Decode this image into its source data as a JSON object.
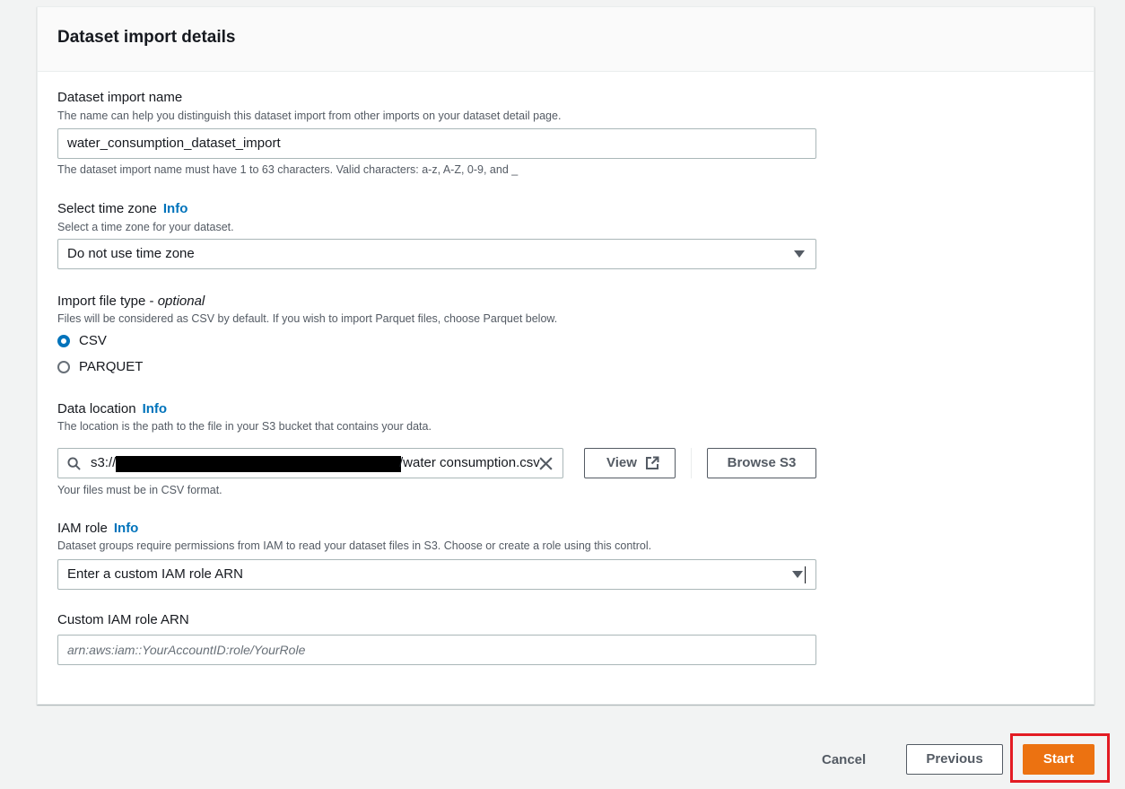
{
  "panel": {
    "title": "Dataset import details"
  },
  "import_name": {
    "label": "Dataset import name",
    "description": "The name can help you distinguish this dataset import from other imports on your dataset detail page.",
    "value": "water_consumption_dataset_import",
    "constraint": "The dataset import name must have 1 to 63 characters. Valid characters: a-z, A-Z, 0-9, and _"
  },
  "time_zone": {
    "label": "Select time zone",
    "info": "Info",
    "description": "Select a time zone for your dataset.",
    "selected": "Do not use time zone"
  },
  "file_type": {
    "label": "Import file type -",
    "label_optional": "optional",
    "description": "Files will be considered as CSV by default. If you wish to import Parquet files, choose Parquet below.",
    "options": [
      {
        "label": "CSV",
        "checked": true
      },
      {
        "label": "PARQUET",
        "checked": false
      }
    ]
  },
  "data_location": {
    "label": "Data location",
    "info": "Info",
    "description": "The location is the path to the file in your S3 bucket that contains your data.",
    "prefix": "s3://",
    "suffix": "/water consumption.csv",
    "hint": "Your files must be in CSV format.",
    "view_label": "View",
    "browse_label": "Browse S3"
  },
  "iam_role": {
    "label": "IAM role",
    "info": "Info",
    "description": "Dataset groups require permissions from IAM to read your dataset files in S3. Choose or create a role using this control.",
    "selected": "Enter a custom IAM role ARN"
  },
  "custom_arn": {
    "label": "Custom IAM role ARN",
    "placeholder": "arn:aws:iam::YourAccountID:role/YourRole"
  },
  "footer": {
    "cancel": "Cancel",
    "previous": "Previous",
    "start": "Start",
    "highlight_color": "#e31b23",
    "primary_color": "#ec7211"
  }
}
